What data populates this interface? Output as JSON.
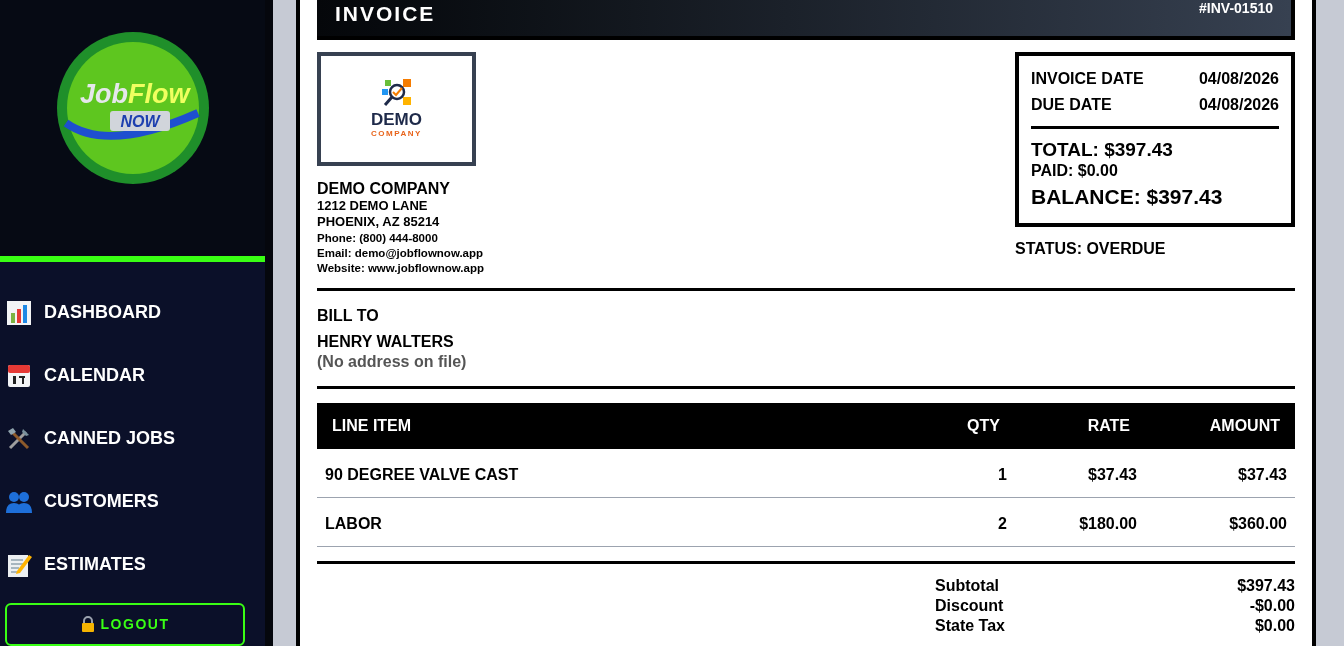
{
  "sidebar": {
    "logo": {
      "word_1": "Job",
      "word_2": "Flow",
      "badge": "NOW"
    },
    "items": [
      {
        "kind": "chart",
        "label": "DASHBOARD"
      },
      {
        "kind": "calendar",
        "label": "CALENDAR"
      },
      {
        "kind": "tools",
        "label": "CANNED JOBS"
      },
      {
        "kind": "people",
        "label": "CUSTOMERS"
      },
      {
        "kind": "memo",
        "label": "ESTIMATES"
      }
    ],
    "logout": "LOGOUT"
  },
  "invoice": {
    "title": "INVOICE",
    "number": "#INV-01510",
    "company_logo": {
      "name": "DEMO",
      "tagline": "COMPANY"
    },
    "company": {
      "name": "DEMO COMPANY",
      "address_1": "1212 DEMO LANE",
      "address_2": "PHOENIX, AZ 85214",
      "phone": "Phone: (800) 444-8000",
      "email": "Email: demo@jobflownow.app",
      "website": "Website: www.jobflownow.app"
    },
    "dates": [
      {
        "label": "INVOICE DATE",
        "value": "04/08/2026"
      },
      {
        "label": "DUE DATE",
        "value": "04/08/2026"
      }
    ],
    "total": "TOTAL: $397.43",
    "paid": "PAID: $0.00",
    "balance": "BALANCE: $397.43",
    "status": "STATUS: OVERDUE",
    "bill_to": {
      "heading": "BILL TO",
      "name": "HENRY WALTERS",
      "address": "(No address on file)"
    },
    "table": {
      "columns": [
        "LINE ITEM",
        "QTY",
        "RATE",
        "AMOUNT"
      ],
      "rows": [
        [
          "90 DEGREE VALVE CAST",
          "1",
          "$37.43",
          "$37.43"
        ],
        [
          "LABOR",
          "2",
          "$180.00",
          "$360.00"
        ]
      ]
    },
    "totals": [
      {
        "label": "Subtotal",
        "value": "$397.43"
      },
      {
        "label": "Discount",
        "value": "-$0.00"
      },
      {
        "label": "State Tax",
        "value": "$0.00"
      }
    ]
  }
}
